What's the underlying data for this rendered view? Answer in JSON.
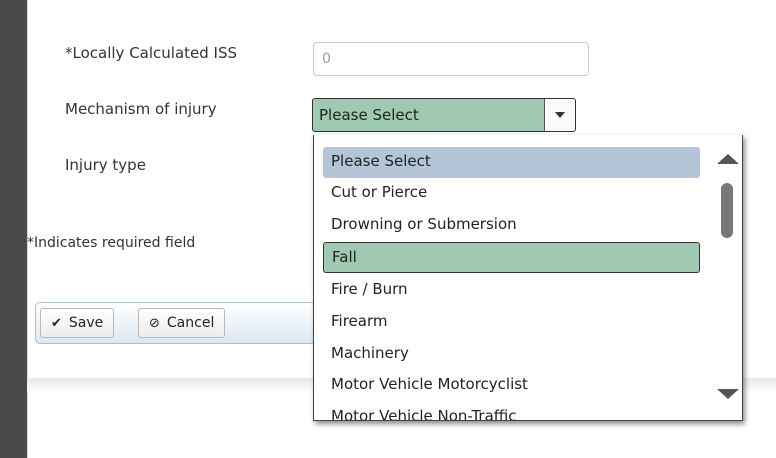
{
  "form": {
    "iss_label": "*Locally Calculated ISS",
    "iss_value": "0",
    "mechanism_label": "Mechanism of injury",
    "mechanism_value": "Please Select",
    "injury_type_label": "Injury type",
    "required_note": "*Indicates required field"
  },
  "toolbar": {
    "save_icon": "✔",
    "save_label": "Save",
    "cancel_icon": "⊘",
    "cancel_label": "Cancel"
  },
  "dropdown": {
    "options": [
      "Please Select",
      "Cut or Pierce",
      "Drowning or Submersion",
      "Fall",
      "Fire / Burn",
      "Firearm",
      "Machinery",
      "Motor Vehicle Motorcyclist",
      "Motor Vehicle Non-Traffic"
    ],
    "highlighted": "Please Select",
    "selected": "Fall"
  },
  "colors": {
    "selected_bg": "#9fc9b1",
    "highlight_bg": "#b3c5d7"
  }
}
